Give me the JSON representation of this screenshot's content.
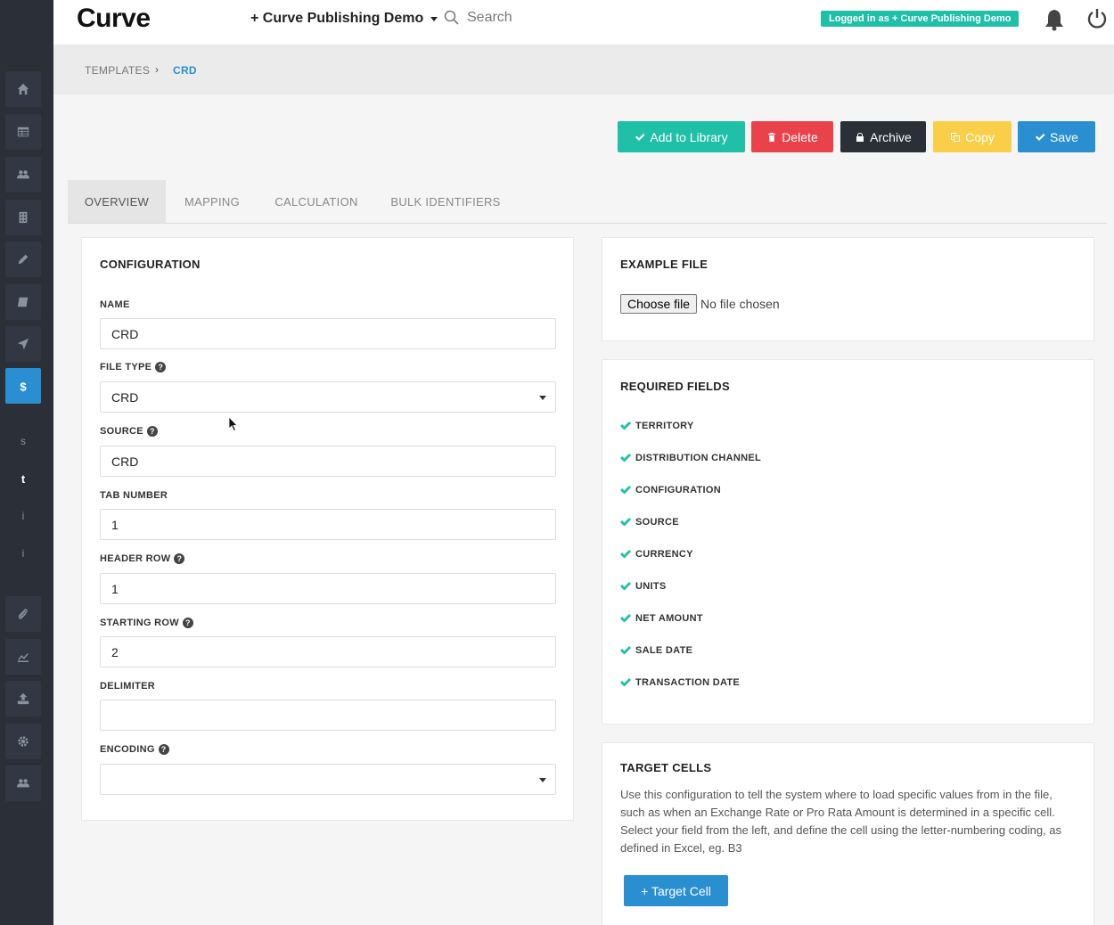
{
  "app": {
    "logo": "Curve",
    "org_name": "+ Curve Publishing Demo",
    "search_placeholder": "Search",
    "logged_in_badge": "Logged in as + Curve Publishing Demo"
  },
  "sidebar": {
    "items": [
      {
        "icon": "home-icon"
      },
      {
        "icon": "table-icon"
      },
      {
        "icon": "users-icon"
      },
      {
        "icon": "building-icon"
      },
      {
        "icon": "pencil-icon"
      },
      {
        "icon": "book-icon"
      },
      {
        "icon": "send-icon"
      },
      {
        "icon": "dollar-icon",
        "active": true
      }
    ],
    "letters": [
      "s",
      "t",
      "i",
      "i"
    ],
    "bottom_items": [
      {
        "icon": "paperclip-icon"
      },
      {
        "icon": "chart-icon"
      },
      {
        "icon": "upload-icon"
      },
      {
        "icon": "gear-icon"
      },
      {
        "icon": "users-icon"
      }
    ]
  },
  "breadcrumb": {
    "parent": "TEMPLATES",
    "separator": "›",
    "current": "CRD"
  },
  "actions": {
    "add_to_library": "Add to Library",
    "delete": "Delete",
    "archive": "Archive",
    "copy": "Copy",
    "save": "Save"
  },
  "colors": {
    "teal": "#1fbfa8",
    "red": "#e9424b",
    "dark": "#2a2f38",
    "yellow": "#f9cf4a",
    "blue": "#2a8fd0"
  },
  "tabs": [
    {
      "label": "OVERVIEW",
      "active": true
    },
    {
      "label": "MAPPING"
    },
    {
      "label": "CALCULATION"
    },
    {
      "label": "BULK IDENTIFIERS"
    }
  ],
  "configuration": {
    "title": "CONFIGURATION",
    "fields": {
      "name": {
        "label": "NAME",
        "value": "CRD"
      },
      "file_type": {
        "label": "FILE TYPE",
        "value": "CRD"
      },
      "source": {
        "label": "SOURCE",
        "value": "CRD"
      },
      "tab_number": {
        "label": "TAB NUMBER",
        "value": "1"
      },
      "header_row": {
        "label": "HEADER ROW",
        "value": "1"
      },
      "starting_row": {
        "label": "STARTING ROW",
        "value": "2"
      },
      "delimiter": {
        "label": "DELIMITER",
        "value": ""
      },
      "encoding": {
        "label": "ENCODING",
        "value": ""
      }
    }
  },
  "example_file": {
    "title": "EXAMPLE FILE",
    "choose_label": "Choose file",
    "status": "No file chosen"
  },
  "required_fields": {
    "title": "REQUIRED FIELDS",
    "items": [
      "TERRITORY",
      "DISTRIBUTION CHANNEL",
      "CONFIGURATION",
      "SOURCE",
      "CURRENCY",
      "UNITS",
      "NET AMOUNT",
      "SALE DATE",
      "TRANSACTION DATE"
    ]
  },
  "target_cells": {
    "title": "TARGET CELLS",
    "description": "Use this configuration to tell the system where to load specific values from in the file, such as when an Exchange Rate or Pro Rata Amount is determined in a specific cell. Select your field from the left, and define the cell using the letter-numbering coding, as defined in Excel, eg. B3",
    "button": "+ Target Cell"
  }
}
